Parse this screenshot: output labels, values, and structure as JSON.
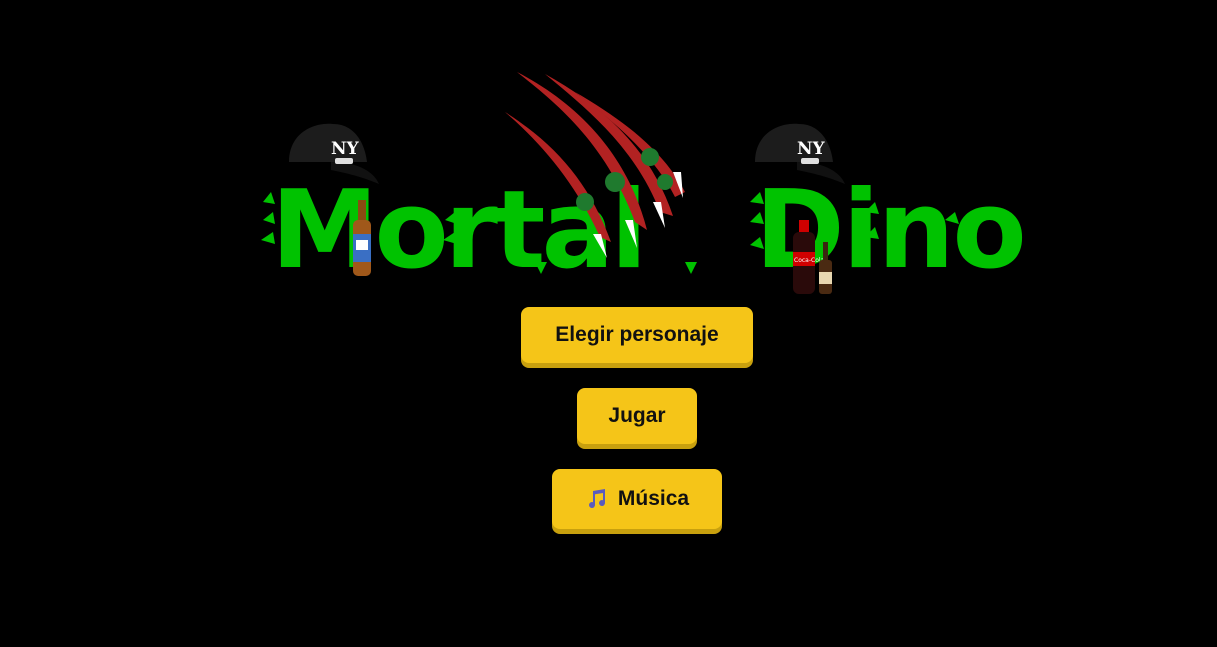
{
  "title": {
    "logo_text": "Mortal Dino",
    "word_1": "Mortal",
    "word_2": "Dino"
  },
  "logo": {
    "icons": [
      "claw-scratch-icon",
      "baseball-cap-icon",
      "beer-bottle-icon",
      "soda-bottle-icon",
      "liquor-bottle-icon"
    ],
    "cap_letters": "NY",
    "cola_label": "Coca-Cola"
  },
  "menu": {
    "elegir_label": "Elegir personaje",
    "jugar_label": "Jugar",
    "musica_label": "Música",
    "musica_icon": "music-note-icon"
  },
  "colors": {
    "background": "#000000",
    "title_green": "#00c200",
    "button_yellow": "#f5c518",
    "claw_red": "#b22222"
  }
}
